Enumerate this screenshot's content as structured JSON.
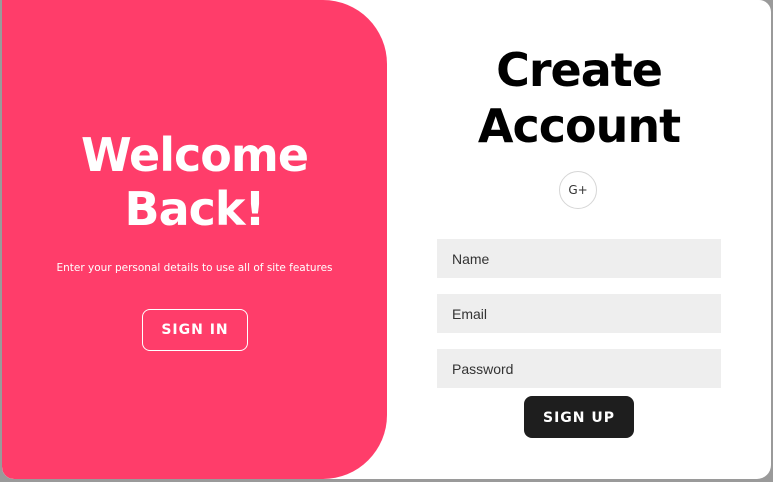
{
  "left_panel": {
    "title_line1": "Welcome",
    "title_line2": "Back!",
    "subtitle": "Enter your personal details to use all of site features",
    "signin_label": "SIGN IN",
    "background_color": "#ff3d6a"
  },
  "right_panel": {
    "title_line1": "Create",
    "title_line2": "Account",
    "social_label": "G+",
    "fields": {
      "name_placeholder": "Name",
      "email_placeholder": "Email",
      "password_placeholder": "Password"
    },
    "signup_label": "SIGN UP",
    "signup_color": "#1e1e1e"
  }
}
